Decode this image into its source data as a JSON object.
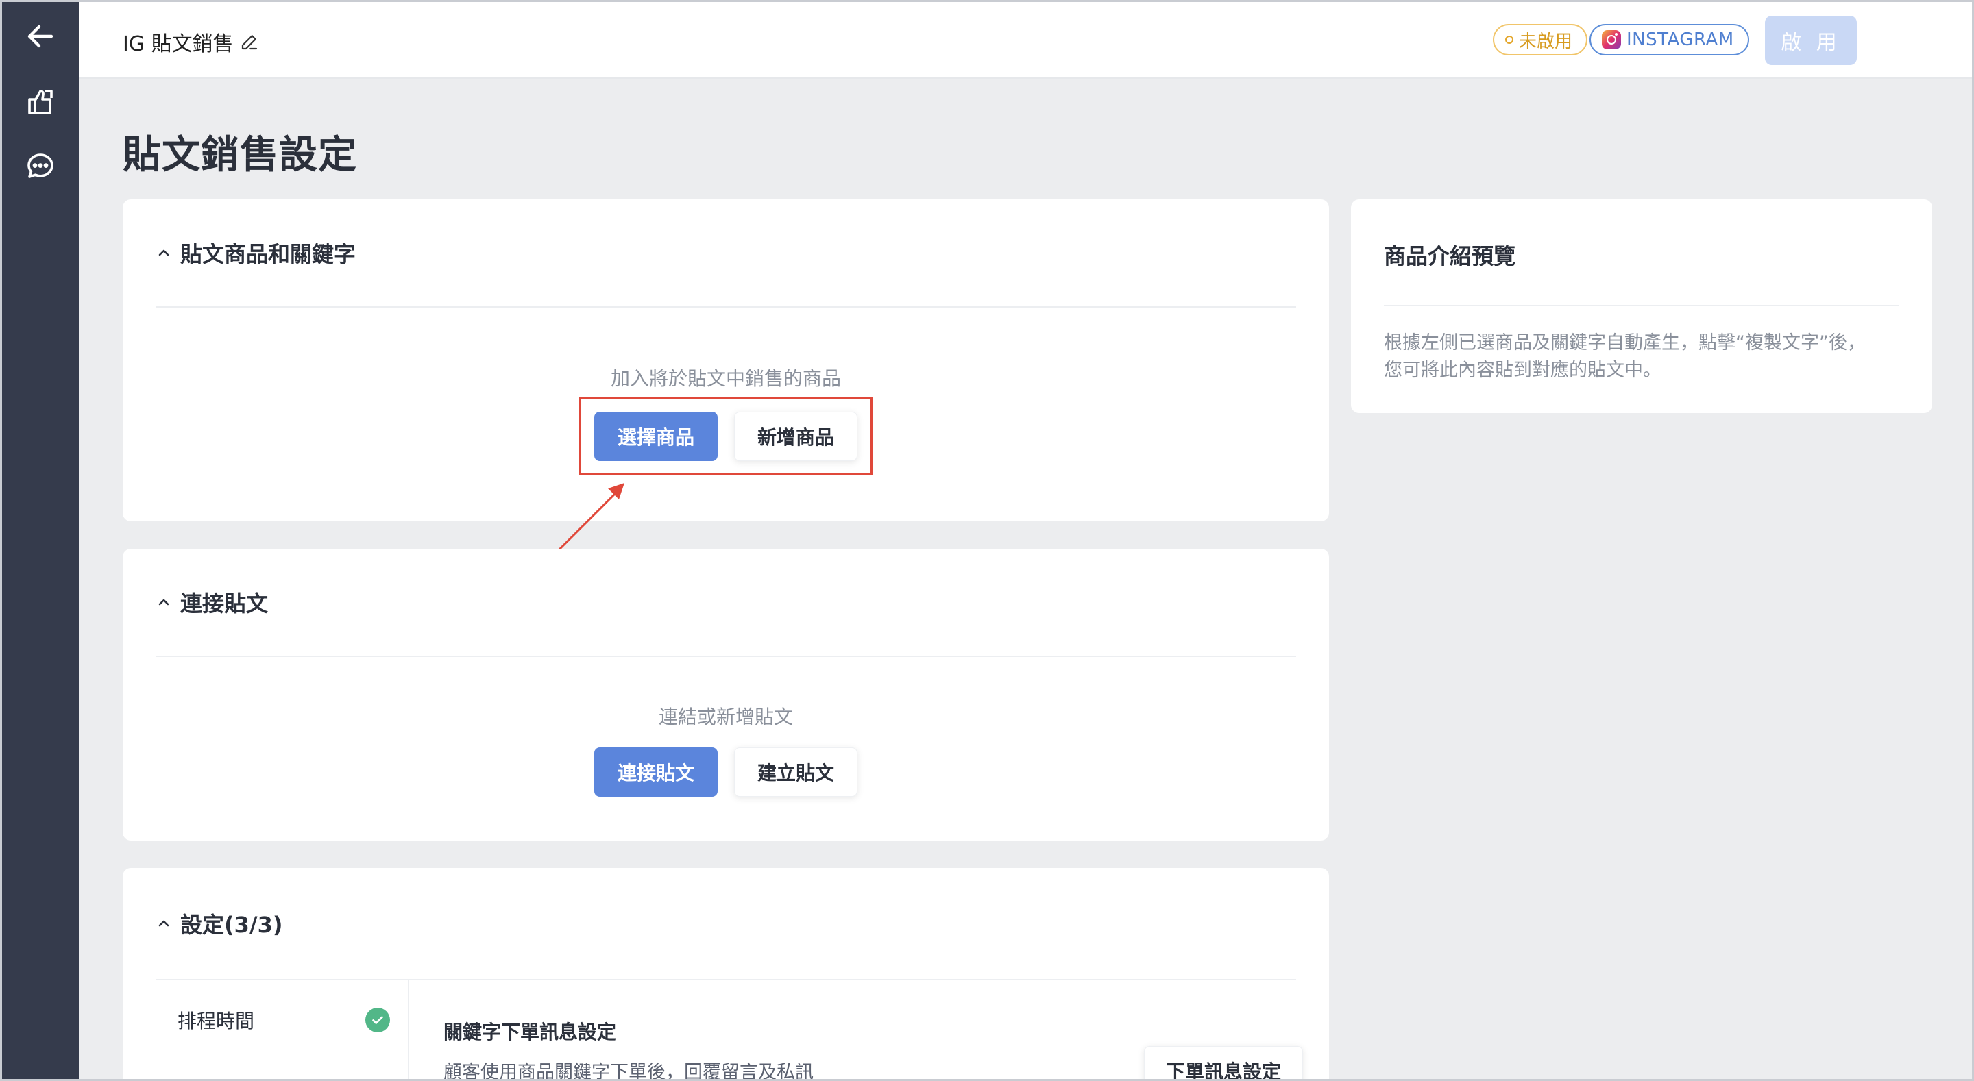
{
  "topbar": {
    "title": "IG 貼文銷售",
    "status_badge": "未啟用",
    "channel_badge": "INSTAGRAM",
    "enable_button": "啟 用"
  },
  "page": {
    "title": "貼文銷售設定"
  },
  "products_card": {
    "header": "貼文商品和關鍵字",
    "hint": "加入將於貼文中銷售的商品",
    "select_button": "選擇商品",
    "add_button": "新增商品"
  },
  "connect_card": {
    "header": "連接貼文",
    "hint": "連結或新增貼文",
    "connect_button": "連接貼文",
    "create_button": "建立貼文"
  },
  "settings_card": {
    "header": "設定(3/3)",
    "side_item": "排程時間",
    "main_title": "關鍵字下單訊息設定",
    "main_desc": "顧客使用商品關鍵字下單後，回覆留言及私訊",
    "action_button": "下單訊息設定"
  },
  "preview_card": {
    "title": "商品介紹預覽",
    "line1": "根據左側已選商品及關鍵字自動產生，點擊“複製文字”後，",
    "line2": "您可將此內容貼到對應的貼文中。"
  },
  "colors": {
    "primary": "#5b85dc",
    "rail": "#353b4c",
    "warning": "#e4a62a",
    "instagram": "#4f7fd0",
    "highlight": "#e0483a",
    "success": "#52b788"
  }
}
